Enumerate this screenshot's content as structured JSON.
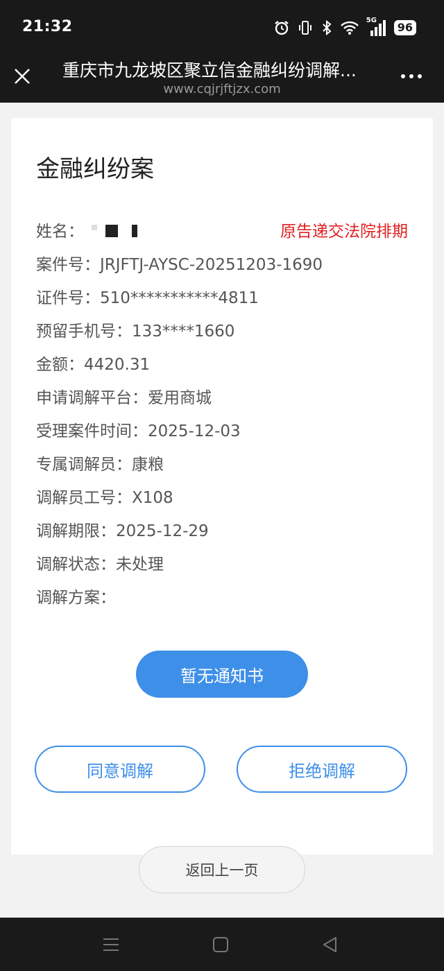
{
  "status_bar": {
    "time": "21:32",
    "network": "5G",
    "battery": "96",
    "icons": [
      "alarm-icon",
      "vibrate-icon",
      "bluetooth-icon",
      "wifi-icon",
      "signal-icon",
      "battery-icon"
    ]
  },
  "header": {
    "title": "重庆市九龙坡区聚立信金融纠纷调解...",
    "url": "www.cqjrjftjzx.com",
    "close_icon": "close-icon",
    "more_icon": "more-dots-icon"
  },
  "card": {
    "title": "金融纠纷案",
    "status_note": "原告递交法院排期",
    "fields": [
      {
        "label": "姓名：",
        "value": ""
      },
      {
        "label": "案件号：",
        "value": "JRJFTJ-AYSC-20251203-1690"
      },
      {
        "label": "证件号：",
        "value": "510***********4811"
      },
      {
        "label": "预留手机号：",
        "value": "133****1660"
      },
      {
        "label": "金额：",
        "value": "4420.31"
      },
      {
        "label": "申请调解平台：",
        "value": "爱用商城"
      },
      {
        "label": "受理案件时间：",
        "value": "2025-12-03"
      },
      {
        "label": "专属调解员：",
        "value": "康粮"
      },
      {
        "label": "调解员工号：",
        "value": "X108"
      },
      {
        "label": "调解期限：",
        "value": "2025-12-29"
      },
      {
        "label": "调解状态：",
        "value": "未处理"
      },
      {
        "label": "调解方案：",
        "value": ""
      }
    ]
  },
  "buttons": {
    "notice": "暂无通知书",
    "agree": "同意调解",
    "refuse": "拒绝调解",
    "back": "返回上一页"
  },
  "navbar": {
    "icons": [
      "menu-icon",
      "home-icon",
      "back-icon"
    ]
  },
  "colors": {
    "accent": "#3e8fe8",
    "status_red": "#e02020",
    "header_bg": "#191919"
  }
}
